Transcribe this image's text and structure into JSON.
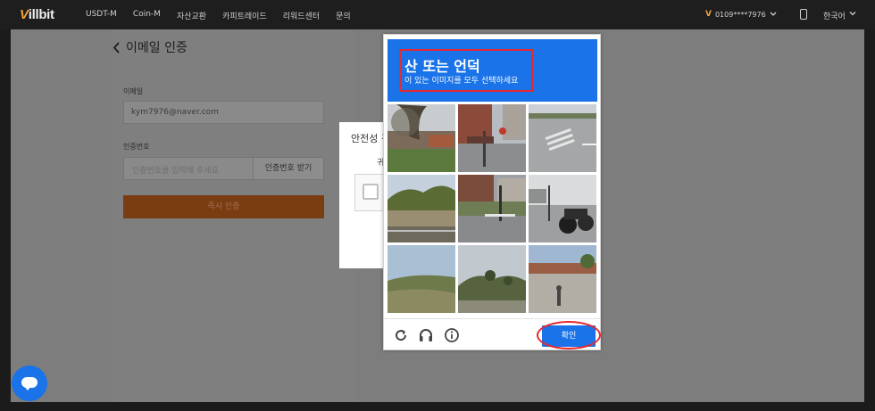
{
  "topbar": {
    "logo_mark": "V",
    "logo_text": "illbit",
    "nav": [
      "USDT-M",
      "Coin-M",
      "자산교환",
      "카피트레이드",
      "리워드센터",
      "문의"
    ],
    "account": "0109****7976",
    "language": "한국어"
  },
  "page": {
    "title": "이메일 인증",
    "email_label": "이메일",
    "email_value": "kym7976@naver.com",
    "code_label": "인증번호",
    "code_placeholder": "인증번호를 입력해 주세요",
    "send_code_button": "인증번호 받기",
    "verify_button": "즉시 인증"
  },
  "bg_modal": {
    "title": "안전성 검",
    "sub": "귀"
  },
  "captcha": {
    "heading": "산 또는 언덕",
    "instruction": "이 있는 이미지를 모두 선택하세요",
    "confirm_button": "확인",
    "tiles": [
      "tile-tree-house",
      "tile-street-building",
      "tile-crosswalk",
      "tile-bridge-trees",
      "tile-street-traffic",
      "tile-motorcycle",
      "tile-hillside-field",
      "tile-hill-trees",
      "tile-parking-lot"
    ],
    "header_color": "#1a73e8",
    "highlight_color": "#e8272d"
  },
  "chat_widget": {
    "icon": "chat-bubble-icon"
  }
}
